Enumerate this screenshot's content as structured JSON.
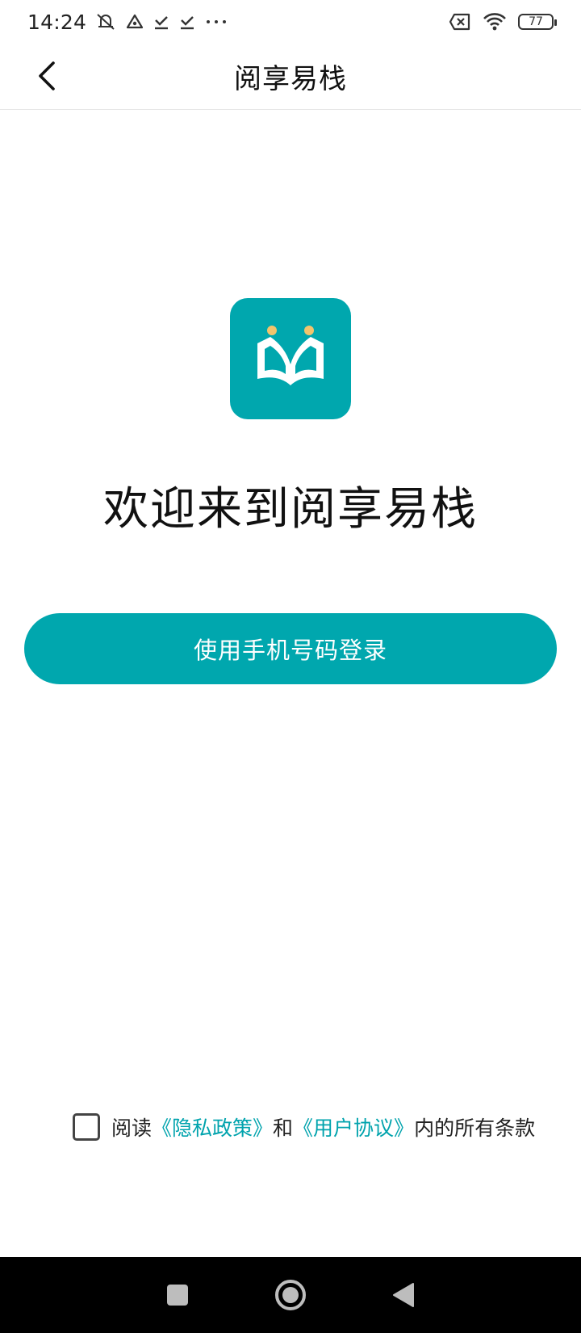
{
  "status_bar": {
    "time": "14:24",
    "battery": "77",
    "icons": [
      "mute-icon",
      "signal-alert-icon",
      "download-done-icon",
      "download-done-icon",
      "more-icon",
      "no-sim-icon",
      "wifi-icon",
      "battery-icon"
    ]
  },
  "header": {
    "title": "阅享易栈",
    "back_icon": "chevron-left-icon"
  },
  "logo": {
    "icon": "open-book-icon",
    "color": "#00a7ae",
    "accent": "#f2c46d"
  },
  "welcome_text": "欢迎来到阅享易栈",
  "login_button": {
    "label": "使用手机号码登录",
    "color": "#00a7ae"
  },
  "agreement": {
    "checked": false,
    "prefix": "阅读",
    "privacy_link": "《隐私政策》",
    "and": "和",
    "user_link": "《用户协议》",
    "suffix": "内的所有条款",
    "link_color": "#00a3ad"
  },
  "nav_bar": {
    "items": [
      "recents-square-icon",
      "home-circle-icon",
      "back-triangle-icon"
    ]
  }
}
